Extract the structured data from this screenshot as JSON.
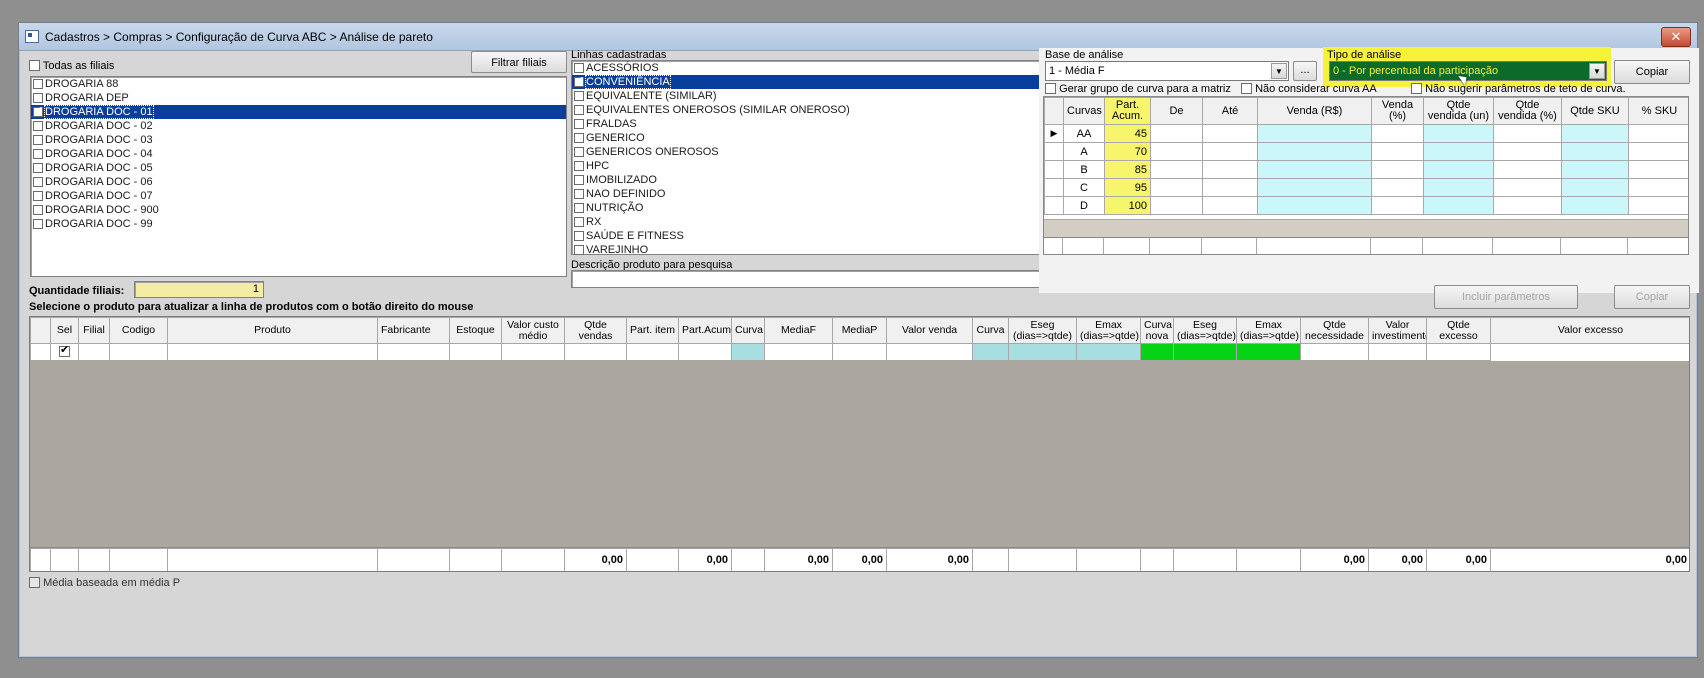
{
  "window": {
    "title": "Cadastros > Compras > Configuração de Curva ABC > Análise de pareto",
    "close_label": "✕"
  },
  "filiais": {
    "todas_label": "Todas as filiais",
    "filtrar_label": "Filtrar filiais",
    "items": [
      {
        "label": "DROGARIA 88",
        "checked": false,
        "selected": false
      },
      {
        "label": "DROGARIA DEP",
        "checked": false,
        "selected": false
      },
      {
        "label": "DROGARIA DOC - 01",
        "checked": true,
        "selected": true
      },
      {
        "label": "DROGARIA DOC - 02",
        "checked": false,
        "selected": false
      },
      {
        "label": "DROGARIA DOC - 03",
        "checked": false,
        "selected": false
      },
      {
        "label": "DROGARIA DOC - 04",
        "checked": false,
        "selected": false
      },
      {
        "label": "DROGARIA DOC - 05",
        "checked": false,
        "selected": false
      },
      {
        "label": "DROGARIA DOC - 06",
        "checked": false,
        "selected": false
      },
      {
        "label": "DROGARIA DOC - 07",
        "checked": false,
        "selected": false
      },
      {
        "label": "DROGARIA DOC - 900",
        "checked": false,
        "selected": false
      },
      {
        "label": "DROGARIA DOC - 99",
        "checked": false,
        "selected": false
      }
    ],
    "quantidade_label": "Quantidade filiais:",
    "quantidade_value": "1"
  },
  "instruction": "Selecione o produto para atualizar a linha de produtos com o botão direito do mouse",
  "linhas": {
    "label": "Linhas cadastradas",
    "items": [
      {
        "label": "ACESSÓRIOS",
        "checked": false,
        "selected": false
      },
      {
        "label": "CONVENIÊNCIA",
        "checked": true,
        "selected": true
      },
      {
        "label": "EQUIVALENTE (SIMILAR)",
        "checked": false,
        "selected": false
      },
      {
        "label": "EQUIVALENTES ONEROSOS (SIMILAR ONEROSO)",
        "checked": false,
        "selected": false
      },
      {
        "label": "FRALDAS",
        "checked": false,
        "selected": false
      },
      {
        "label": "GENERICO",
        "checked": false,
        "selected": false
      },
      {
        "label": "GENERICOS ONEROSOS",
        "checked": false,
        "selected": false
      },
      {
        "label": "HPC",
        "checked": false,
        "selected": false
      },
      {
        "label": "IMOBILIZADO",
        "checked": false,
        "selected": false
      },
      {
        "label": "NAO DEFINIDO",
        "checked": false,
        "selected": false
      },
      {
        "label": "NUTRIÇÃO",
        "checked": false,
        "selected": false
      },
      {
        "label": "RX",
        "checked": false,
        "selected": false
      },
      {
        "label": "SAÚDE E FITNESS",
        "checked": false,
        "selected": false
      },
      {
        "label": "VAREJINHO",
        "checked": false,
        "selected": false
      }
    ],
    "descricao_label": "Descrição produto para pesquisa",
    "descricao_value": ""
  },
  "analise": {
    "base_label": "Base de análise",
    "base_value": "1 - Média F",
    "ellipsis_label": "...",
    "tipo_label": "Tipo de análise",
    "tipo_value": "0 - Por percentual da participação",
    "copiar_label": "Copiar",
    "chk_gerar": "Gerar grupo de curva para a matriz",
    "chk_nao_considerar": "Não considerar curva AA",
    "chk_nao_sugerir": "Não sugerir parâmetros de teto de curva.",
    "incluir_label": "Incluir parâmetros",
    "copiar2_label": "Copiar"
  },
  "curvas_table": {
    "headers": [
      "Curvas",
      "Part. Acum.",
      "De",
      "Até",
      "Venda (R$)",
      "Venda (%)",
      "Qtde vendida (un)",
      "Qtde vendida (%)",
      "Qtde SKU",
      "% SKU"
    ],
    "rows": [
      {
        "curva": "AA",
        "part": "45",
        "current": true
      },
      {
        "curva": "A",
        "part": "70",
        "current": false
      },
      {
        "curva": "B",
        "part": "85",
        "current": false
      },
      {
        "curva": "C",
        "part": "95",
        "current": false
      },
      {
        "curva": "D",
        "part": "100",
        "current": false
      }
    ]
  },
  "produtos_table": {
    "headers": [
      "Sel",
      "Filial",
      "Codigo",
      "Produto",
      "Fabricante",
      "Estoque",
      "Valor custo médio",
      "Qtde vendas",
      "Part. item",
      "Part.Acum.",
      "Curva",
      "MediaF",
      "MediaP",
      "Valor venda",
      "Curva",
      "Eseg (dias=>qtde)",
      "Emax (dias=>qtde)",
      "Curva nova",
      "Eseg (dias=>qtde)",
      "Emax (dias=>qtde)",
      "Qtde necessidade",
      "Valor investimento",
      "Qtde excesso",
      "Valor excesso"
    ],
    "footer": [
      "",
      "",
      "",
      "",
      "",
      "",
      "",
      "0,00",
      "",
      "0,00",
      "",
      "0,00",
      "0,00",
      "0,00",
      "",
      "",
      "",
      "",
      "",
      "",
      "0,00",
      "0,00",
      "0,00",
      "0,00"
    ]
  },
  "media_p_label": "Média baseada em média P"
}
